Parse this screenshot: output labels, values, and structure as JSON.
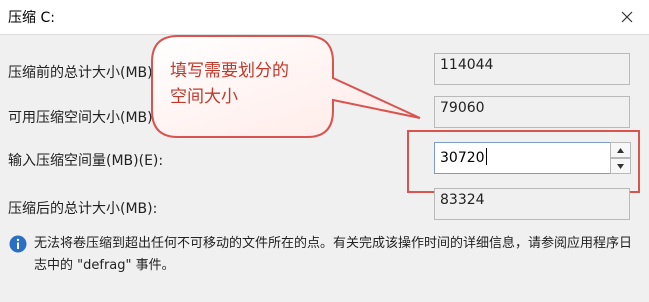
{
  "window": {
    "title": "压缩 C:"
  },
  "rows": [
    {
      "label": "压缩前的总计大小(MB):",
      "value": "114044"
    },
    {
      "label": "可用压缩空间大小(MB):",
      "value": "79060"
    },
    {
      "label": "输入压缩空间量(MB)(E):",
      "value": "30720"
    },
    {
      "label": "压缩后的总计大小(MB):",
      "value": "83324"
    }
  ],
  "info": {
    "text": "无法将卷压缩到超出任何不可移动的文件所在的点。有关完成该操作时间的详细信息，请参阅应用程序日志中的 \"defrag\" 事件。"
  },
  "annotation": {
    "line1": "填写需要划分的",
    "line2": "空间大小",
    "color": "#c0392b"
  }
}
